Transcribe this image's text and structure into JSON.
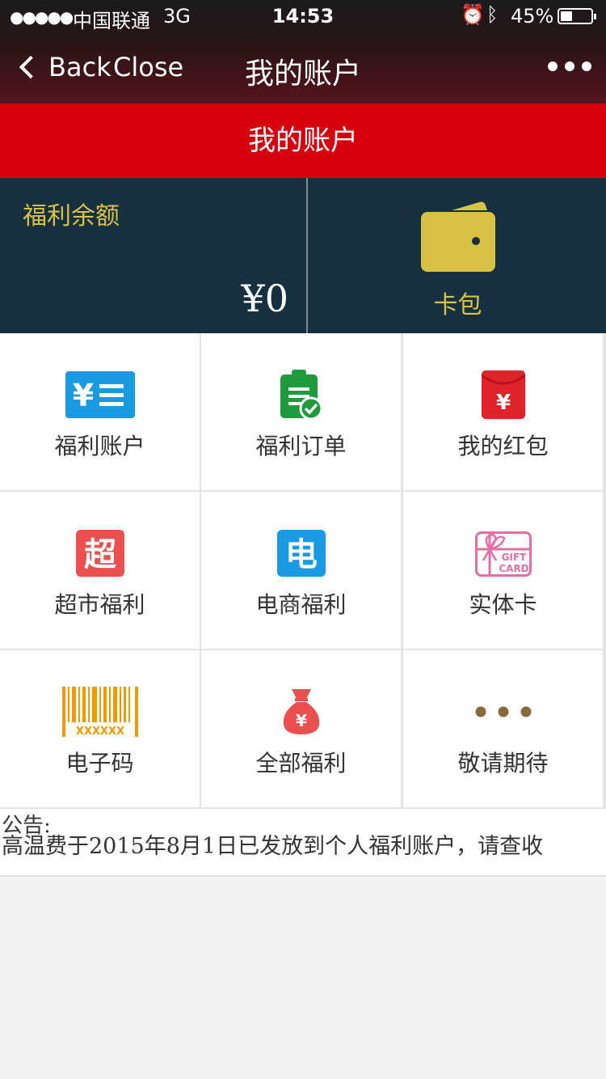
{
  "status_bar": {
    "signal": "●●●●●",
    "carrier": "中国联通",
    "network": "3G",
    "time": "14:53",
    "battery_percent": "45%",
    "battery_level": 0.45
  },
  "nav": {
    "back_label": "Back",
    "close_label": "Close",
    "title": "我的账户"
  },
  "header": {
    "title": "我的账户"
  },
  "balance": {
    "label": "福利余额",
    "amount": "¥0",
    "wallet_label": "卡包",
    "wallet_icon": "wallet-icon",
    "accent_color": "#d8c245"
  },
  "grid": {
    "items": [
      {
        "label": "福利账户",
        "icon": "account-icon",
        "color": "#1a9ae0"
      },
      {
        "label": "福利订单",
        "icon": "order-clipboard-icon",
        "color": "#1f9a3c"
      },
      {
        "label": "我的红包",
        "icon": "red-envelope-icon",
        "color": "#e0222b"
      },
      {
        "label": "超市福利",
        "icon": "supermarket-icon",
        "icon_text": "超",
        "color": "#ea5050"
      },
      {
        "label": "电商福利",
        "icon": "ecommerce-icon",
        "icon_text": "电",
        "color": "#1a9ae0"
      },
      {
        "label": "实体卡",
        "icon": "gift-card-icon",
        "icon_text": "GIFT CARD",
        "color": "#e56fa5"
      },
      {
        "label": "电子码",
        "icon": "barcode-icon",
        "icon_text": "XXXXXX",
        "color": "#f09a00"
      },
      {
        "label": "全部福利",
        "icon": "money-bag-icon",
        "color": "#ea5050"
      },
      {
        "label": "敬请期待",
        "icon": "more-dots-icon",
        "color": "#8a6a3a"
      }
    ]
  },
  "notice": {
    "heading": "公告:",
    "text": "高温费于2015年8月1日已发放到个人福利账户，请查收"
  },
  "colors": {
    "header_red": "#d7000f",
    "panel_bg": "#17303f"
  }
}
